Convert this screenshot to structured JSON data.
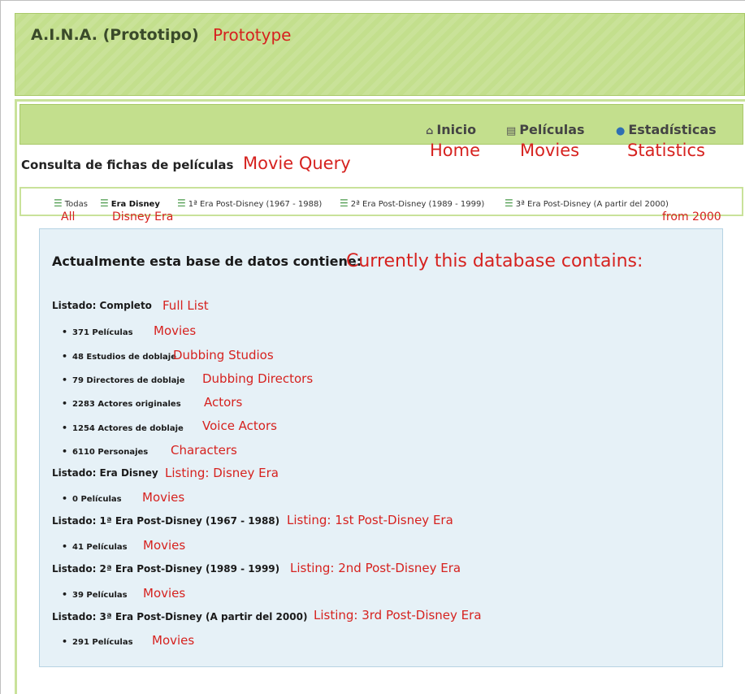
{
  "header": {
    "title": "A.I.N.A. (Prototipo)",
    "title_note": "Prototype"
  },
  "nav": {
    "items": [
      {
        "icon": "home-icon",
        "label": "Inicio",
        "note": "Home"
      },
      {
        "icon": "clapperboard-icon",
        "label": "Películas",
        "note": "Movies"
      },
      {
        "icon": "pie-chart-icon",
        "label": "Estadísticas",
        "note": "Statistics"
      }
    ]
  },
  "page": {
    "heading": "Consulta de fichas de películas",
    "heading_note": "Movie Query"
  },
  "filters": {
    "items": [
      {
        "label": "Todas",
        "note": "All",
        "active": false
      },
      {
        "label": "Era Disney",
        "note": "Disney Era",
        "active": true
      },
      {
        "label": "1ª Era Post-Disney (1967 - 1988)",
        "note": "",
        "active": false
      },
      {
        "label": "2ª Era Post-Disney (1989 - 1999)",
        "note": "",
        "active": false
      },
      {
        "label": "3ª Era Post-Disney (A partir del 2000)",
        "note": "from 2000",
        "active": false
      }
    ]
  },
  "database": {
    "title": "Actualmente esta base de datos contiene:",
    "title_note": "Currently this database contains:",
    "sections": [
      {
        "heading": "Listado: Completo",
        "note": "Full List",
        "items": [
          {
            "text": "371 Películas",
            "note": "Movies"
          },
          {
            "text": "48 Estudios de doblaje",
            "note": "Dubbing Studios"
          },
          {
            "text": "79 Directores de doblaje",
            "note": "Dubbing Directors"
          },
          {
            "text": "2283 Actores originales",
            "note": "Actors"
          },
          {
            "text": "1254 Actores de doblaje",
            "note": "Voice Actors"
          },
          {
            "text": "6110 Personajes",
            "note": "Characters"
          }
        ]
      },
      {
        "heading": "Listado: Era Disney",
        "note": "Listing: Disney Era",
        "items": [
          {
            "text": "0 Películas",
            "note": "Movies"
          }
        ]
      },
      {
        "heading": "Listado: 1ª Era Post-Disney (1967 - 1988)",
        "note": "Listing: 1st Post-Disney Era",
        "items": [
          {
            "text": "41 Películas",
            "note": "Movies"
          }
        ]
      },
      {
        "heading": "Listado: 2ª Era Post-Disney (1989 - 1999)",
        "note": "Listing: 2nd Post-Disney Era",
        "items": [
          {
            "text": "39 Películas",
            "note": "Movies"
          }
        ]
      },
      {
        "heading": "Listado: 3ª Era Post-Disney (A partir del 2000)",
        "note": "Listing: 3rd Post-Disney Era",
        "items": [
          {
            "text": "291 Películas",
            "note": "Movies"
          }
        ]
      }
    ]
  },
  "colors": {
    "banner_green": "#c3df8d",
    "annotation_red": "#d6221f",
    "info_box_blue": "#e6f1f7"
  }
}
